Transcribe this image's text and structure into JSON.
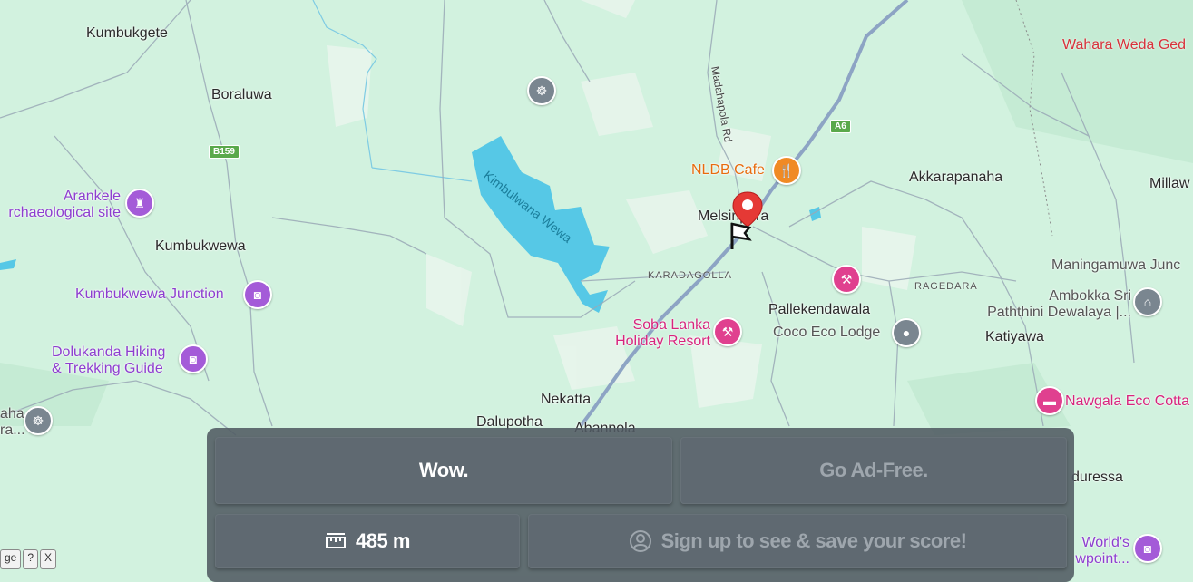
{
  "map": {
    "towns": [
      "Kumbukgete",
      "Boraluwa",
      "Kumbukwewa",
      "Melsiripura",
      "Akkarapanaha",
      "Millaw",
      "Pallekendawala",
      "Katiyawa",
      "Nekatta",
      "Dalupotha",
      "Abannola",
      "duressa"
    ],
    "areas": [
      "KARADAGOLLA",
      "RAGEDARA"
    ],
    "water": [
      "Kimbulwana Wewa"
    ],
    "roads": [
      "Madahapola Rd"
    ],
    "road_shields": [
      "A6",
      "B159"
    ],
    "pois": {
      "arankele": [
        "Arankele",
        "rchaeological site"
      ],
      "kumbukwewa_junction": "Kumbukwewa Junction",
      "dolukanda": [
        "Dolukanda Hiking",
        "& Trekking Guide"
      ],
      "left_edge": [
        "aha",
        "ra..."
      ],
      "nldb_cafe": "NLDB Cafe",
      "soba_lanka": [
        "Soba Lanka",
        "Holiday Resort"
      ],
      "coco_eco": "Coco Eco Lodge",
      "maningamuwa": "Maningamuwa Junc",
      "ambokka": [
        "Ambokka Sri",
        "Paththini Dewalaya |..."
      ],
      "nawgala": "Nawgala Eco Cotta",
      "worlds": [
        "World's",
        "wpoint..."
      ],
      "wahara": "Wahara Weda Ged"
    }
  },
  "panel": {
    "wow_label": "Wow.",
    "adfree_label": "Go Ad-Free.",
    "distance_label": "485 m",
    "signup_label": "Sign up to see & save your score!"
  },
  "attribution": {
    "text": "ge",
    "help": "?",
    "close": "X"
  },
  "colors": {
    "land": "#d2f2df",
    "water": "#56c8e6",
    "road": "#8da4c4",
    "pin": "#e53935",
    "panel": "#505a62"
  }
}
